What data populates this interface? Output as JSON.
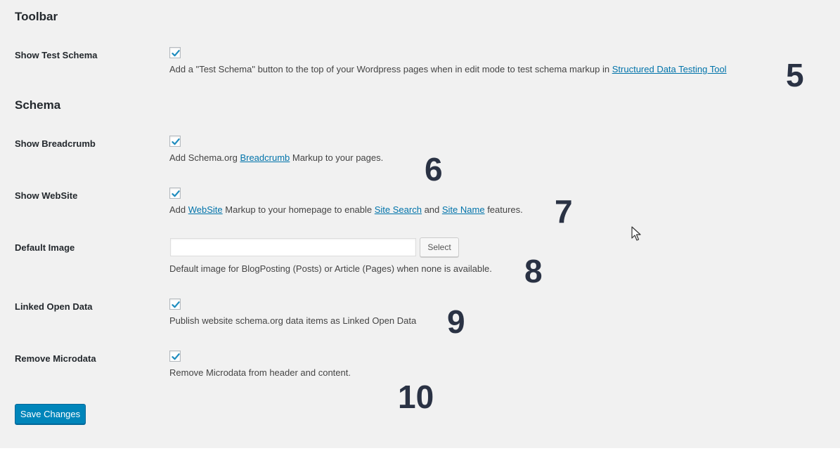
{
  "toolbar_section": {
    "title": "Toolbar",
    "test_schema": {
      "label": "Show Test Schema",
      "checked": true,
      "desc_prefix": "Add a \"Test Schema\" button to the top of your Wordpress pages when in edit mode to test schema markup in ",
      "link": "Structured Data Testing Tool"
    }
  },
  "schema_section": {
    "title": "Schema",
    "breadcrumb": {
      "label": "Show Breadcrumb",
      "checked": true,
      "desc_prefix": "Add Schema.org ",
      "link": "Breadcrumb",
      "desc_suffix": " Markup to your pages."
    },
    "website": {
      "label": "Show WebSite",
      "checked": true,
      "desc_1": "Add ",
      "link_1": "WebSite",
      "desc_2": " Markup to your homepage to enable ",
      "link_2": "Site Search",
      "desc_3": " and ",
      "link_3": "Site Name",
      "desc_4": " features."
    },
    "default_image": {
      "label": "Default Image",
      "value": "",
      "select_label": "Select",
      "desc": "Default image for BlogPosting (Posts) or Article (Pages) when none is available."
    },
    "linked_open_data": {
      "label": "Linked Open Data",
      "checked": true,
      "desc": "Publish website schema.org data items as Linked Open Data"
    },
    "remove_microdata": {
      "label": "Remove Microdata",
      "checked": true,
      "desc": "Remove Microdata from header and content."
    }
  },
  "save_label": "Save Changes",
  "annotations": [
    "5",
    "6",
    "7",
    "8",
    "9",
    "10"
  ],
  "colors": {
    "panel_bg": "#f1f1f1",
    "link": "#0073aa",
    "primary_button": "#0085ba",
    "checkmark": "#1e8cbe"
  },
  "icons": {
    "checkbox_check": "checkmark-icon",
    "cursor": "mouse-pointer-icon"
  }
}
